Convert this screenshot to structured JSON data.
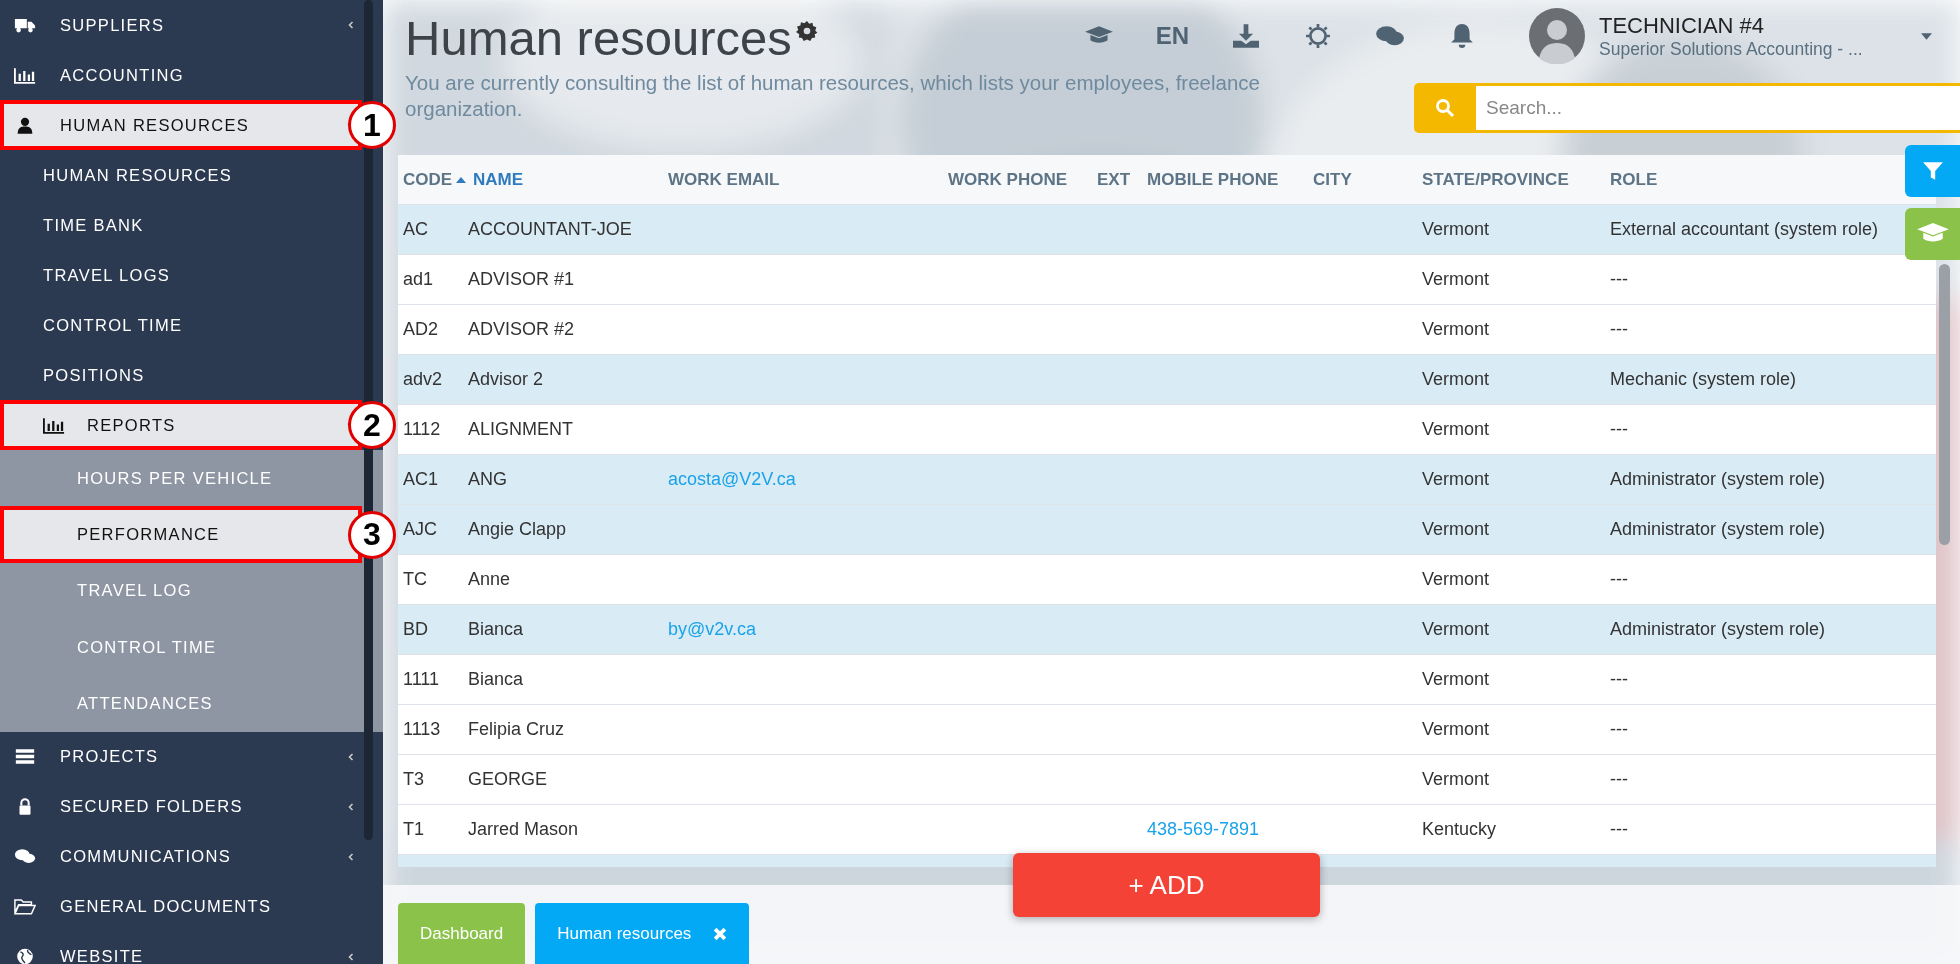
{
  "sidebar": {
    "items": [
      {
        "kind": "menu",
        "label": "SUPPLIERS",
        "expanded": false,
        "selected": false
      },
      {
        "kind": "link",
        "label": "ACCOUNTING",
        "selected": false
      },
      {
        "kind": "menu",
        "label": "HUMAN RESOURCES",
        "expanded": true,
        "selected": true,
        "callout": "1",
        "children": [
          {
            "kind": "link",
            "label": "HUMAN RESOURCES",
            "selected": false
          },
          {
            "kind": "link",
            "label": "TIME BANK",
            "selected": false
          },
          {
            "kind": "link",
            "label": "TRAVEL LOGS",
            "selected": false
          },
          {
            "kind": "link",
            "label": "CONTROL TIME",
            "selected": false
          },
          {
            "kind": "link",
            "label": "POSITIONS",
            "selected": false
          },
          {
            "kind": "menu",
            "label": "REPORTS",
            "expanded": true,
            "selected": true,
            "callout": "2",
            "children": [
              {
                "kind": "link",
                "label": "HOURS PER VEHICLE",
                "selected": false
              },
              {
                "kind": "link",
                "label": "PERFORMANCE",
                "selected": true,
                "callout": "3"
              },
              {
                "kind": "link",
                "label": "TRAVEL LOG",
                "selected": false
              },
              {
                "kind": "link",
                "label": "CONTROL TIME",
                "selected": false
              },
              {
                "kind": "link",
                "label": "ATTENDANCES",
                "selected": false
              }
            ]
          }
        ]
      },
      {
        "kind": "menu",
        "label": "PROJECTS",
        "expanded": false,
        "selected": false
      },
      {
        "kind": "menu",
        "label": "SECURED FOLDERS",
        "expanded": false,
        "selected": false
      },
      {
        "kind": "menu",
        "label": "COMMUNICATIONS",
        "expanded": false,
        "selected": false
      },
      {
        "kind": "link",
        "label": "GENERAL DOCUMENTS",
        "selected": false
      },
      {
        "kind": "menu",
        "label": "WEBSITE",
        "expanded": false,
        "selected": false
      }
    ]
  },
  "header": {
    "title": "Human resources",
    "subtitle_lines": [
      "You are currently consulting the list of human resources, which lists your employees, freelance",
      "organization."
    ],
    "language": "EN",
    "user": {
      "name": "TECHNICIAN #4",
      "company": "Superior Solutions Accounting - ..."
    }
  },
  "search": {
    "placeholder": "Search..."
  },
  "table": {
    "columns": [
      {
        "label": "CODE",
        "sorted": false
      },
      {
        "label": "NAME",
        "sorted": true
      },
      {
        "label": "WORK EMAIL",
        "sorted": false
      },
      {
        "label": "WORK PHONE",
        "sorted": false
      },
      {
        "label": "EXT",
        "sorted": false
      },
      {
        "label": "MOBILE PHONE",
        "sorted": false
      },
      {
        "label": "CITY",
        "sorted": false
      },
      {
        "label": "STATE/PROVINCE",
        "sorted": false
      },
      {
        "label": "ROLE",
        "sorted": false
      }
    ],
    "rows": [
      {
        "code": "AC",
        "name": "ACCOUNTANT-JOE",
        "state_province": "Vermont",
        "role": "External accountant (system role)",
        "selected": true
      },
      {
        "code": "ad1",
        "name": "ADVISOR #1",
        "state_province": "Vermont",
        "role": "---",
        "selected": false
      },
      {
        "code": "AD2",
        "name": "ADVISOR #2",
        "state_province": "Vermont",
        "role": "---",
        "selected": false
      },
      {
        "code": "adv2",
        "name": "Advisor 2",
        "state_province": "Vermont",
        "role": "Mechanic (system role)",
        "selected": true
      },
      {
        "code": "1112",
        "name": "ALIGNMENT",
        "state_province": "Vermont",
        "role": "---",
        "selected": false
      },
      {
        "code": "AC1",
        "name": "ANG",
        "work_email": "acosta@V2V.ca",
        "state_province": "Vermont",
        "role": "Administrator (system role)",
        "selected": true
      },
      {
        "code": "AJC",
        "name": "Angie Clapp",
        "state_province": "Vermont",
        "role": "Administrator (system role)",
        "selected": true
      },
      {
        "code": "TC",
        "name": "Anne",
        "state_province": "Vermont",
        "role": "---",
        "selected": false
      },
      {
        "code": "BD",
        "name": "Bianca",
        "work_email": "by@v2v.ca",
        "state_province": "Vermont",
        "role": "Administrator (system role)",
        "selected": true
      },
      {
        "code": "1111",
        "name": "Bianca",
        "state_province": "Vermont",
        "role": "---",
        "selected": false
      },
      {
        "code": "1113",
        "name": "Felipia Cruz",
        "state_province": "Vermont",
        "role": "---",
        "selected": false
      },
      {
        "code": "T3",
        "name": "GEORGE",
        "state_province": "Vermont",
        "role": "---",
        "selected": false
      },
      {
        "code": "T1",
        "name": "Jarred Mason",
        "mobile_phone": "438-569-7891",
        "state_province": "Kentucky",
        "role": "---",
        "selected": false
      }
    ]
  },
  "add_button": {
    "label": "+ ADD"
  },
  "open_tabs": [
    {
      "label": "Dashboard",
      "kind": "home"
    },
    {
      "label": "Human resources",
      "kind": "page",
      "closable": true
    }
  ]
}
